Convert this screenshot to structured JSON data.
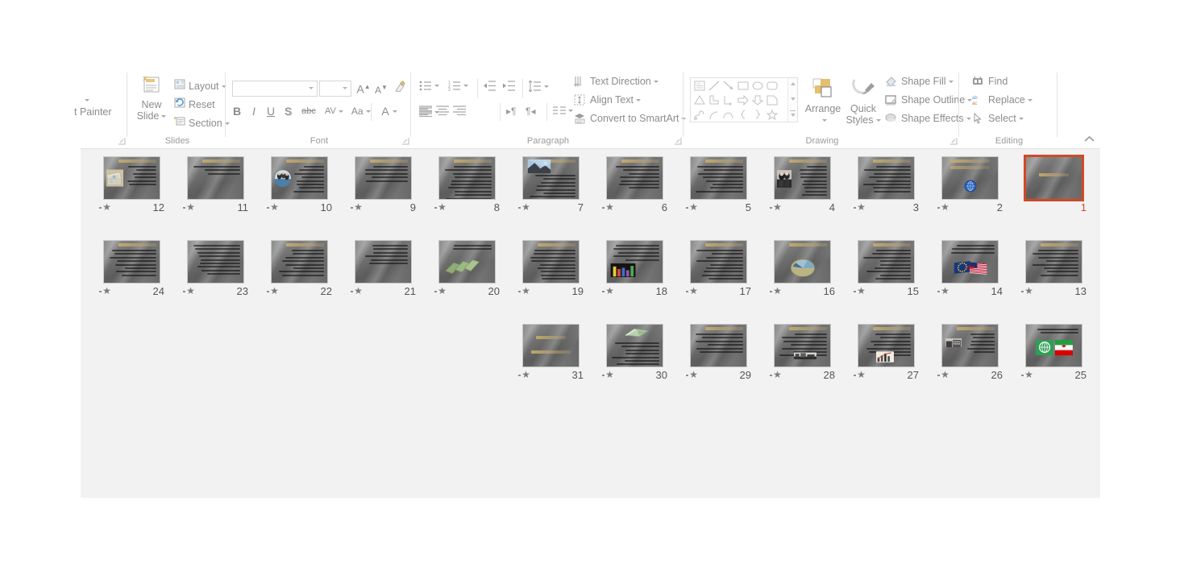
{
  "app": {
    "name": "Microsoft PowerPoint",
    "view": "slide-sorter"
  },
  "ribbon": {
    "groups": [
      {
        "id": "clipboard",
        "label": "",
        "dialog_launcher": true
      },
      {
        "id": "slides",
        "label": "Slides",
        "dialog_launcher": false
      },
      {
        "id": "font",
        "label": "Font",
        "dialog_launcher": true
      },
      {
        "id": "paragraph",
        "label": "Paragraph",
        "dialog_launcher": true
      },
      {
        "id": "drawing",
        "label": "Drawing",
        "dialog_launcher": true
      },
      {
        "id": "editing",
        "label": "Editing",
        "dialog_launcher": false
      }
    ],
    "clipboard": {
      "format_painter_label": "t Painter"
    },
    "slides": {
      "new_slide_line1": "New",
      "new_slide_line2": "Slide",
      "layout_label": "Layout",
      "reset_label": "Reset",
      "section_label": "Section"
    },
    "font": {
      "font_name_value": "",
      "font_size_value": "",
      "grow_font": "A",
      "shrink_font": "A",
      "clear_formatting": "clear-formatting-icon",
      "bold": "B",
      "italic": "I",
      "underline": "U",
      "shadow": "S",
      "strikethrough": "abc",
      "char_spacing": "AV",
      "change_case": "Aa",
      "font_color": "A"
    },
    "paragraph": {
      "text_direction_label": "Text Direction",
      "align_text_label": "Align Text",
      "convert_smartart_label": "Convert to SmartArt"
    },
    "drawing": {
      "arrange_label": "Arrange",
      "quick_styles_line1": "Quick",
      "quick_styles_line2": "Styles",
      "shape_fill_label": "Shape Fill",
      "shape_outline_label": "Shape Outline",
      "shape_effects_label": "Shape Effects"
    },
    "editing": {
      "find_label": "Find",
      "replace_label": "Replace",
      "select_label": "Select"
    },
    "collapse_ribbon": "collapse-ribbon-icon"
  },
  "slides_panel": {
    "selected_slide": 1,
    "total_rows": 3,
    "rows": [
      {
        "row": 1,
        "slides": [
          {
            "number": "12",
            "kind": "image-left",
            "title": true,
            "lines": 6,
            "animated": true,
            "img": "money"
          },
          {
            "number": "11",
            "kind": "text",
            "title": true,
            "lines": 3,
            "animated": true
          },
          {
            "number": "10",
            "kind": "image-left",
            "title": true,
            "lines": 8,
            "animated": true,
            "img": "globe-people"
          },
          {
            "number": "9",
            "kind": "text",
            "title": true,
            "lines": 5,
            "animated": true
          },
          {
            "number": "8",
            "kind": "text",
            "title": true,
            "lines": 10,
            "animated": true
          },
          {
            "number": "7",
            "kind": "image-top",
            "title": true,
            "lines": 8,
            "animated": true,
            "img": "photo-blue"
          },
          {
            "number": "6",
            "kind": "text",
            "title": true,
            "lines": 7,
            "animated": true
          },
          {
            "number": "5",
            "kind": "text",
            "title": true,
            "lines": 8,
            "animated": true
          },
          {
            "number": "4",
            "kind": "image-left",
            "title": true,
            "lines": 9,
            "animated": true,
            "img": "bw-photo"
          },
          {
            "number": "3",
            "kind": "text",
            "title": true,
            "lines": 8,
            "animated": true
          },
          {
            "number": "2",
            "kind": "title-logo",
            "heading": "International Monetary Fund (IMF)",
            "animated": true,
            "img": "imf-logo"
          },
          {
            "number": "1",
            "kind": "title-only",
            "selected": true,
            "animated": false
          }
        ]
      },
      {
        "row": 2,
        "slides": [
          {
            "number": "24",
            "kind": "text",
            "title": true,
            "lines": 8,
            "animated": true
          },
          {
            "number": "23",
            "kind": "text",
            "title": false,
            "lines": 9,
            "animated": true
          },
          {
            "number": "22",
            "kind": "text",
            "title": true,
            "lines": 8,
            "animated": true
          },
          {
            "number": "21",
            "kind": "text",
            "title": false,
            "lines": 6,
            "animated": true
          },
          {
            "number": "20",
            "kind": "image-center",
            "title": false,
            "lines": 2,
            "animated": true,
            "img": "green-cards"
          },
          {
            "number": "19",
            "kind": "text",
            "title": true,
            "lines": 9,
            "animated": true
          },
          {
            "number": "18",
            "kind": "image-center",
            "title": false,
            "lines": 5,
            "animated": true,
            "img": "bar-chart-color"
          },
          {
            "number": "17",
            "kind": "text",
            "title": true,
            "lines": 9,
            "animated": true
          },
          {
            "number": "16",
            "kind": "chart",
            "title": true,
            "animated": true,
            "img": "pie-chart"
          },
          {
            "number": "15",
            "kind": "text",
            "title": true,
            "lines": 9,
            "animated": true
          },
          {
            "number": "14",
            "kind": "image-center",
            "title": false,
            "lines": 3,
            "animated": true,
            "img": "flags-eu-us"
          },
          {
            "number": "13",
            "kind": "text",
            "title": true,
            "lines": 8,
            "animated": true
          }
        ]
      },
      {
        "row": 3,
        "slides": [
          {
            "number": "31",
            "kind": "title-only",
            "animated": true
          },
          {
            "number": "30",
            "kind": "image-top",
            "title": false,
            "lines": 9,
            "animated": true,
            "img": "green-book"
          },
          {
            "number": "29",
            "kind": "text",
            "title": true,
            "lines": 6,
            "animated": true
          },
          {
            "number": "28",
            "kind": "image-center",
            "title": true,
            "lines": 7,
            "animated": true,
            "img": "bw-strip"
          },
          {
            "number": "27",
            "kind": "image-center",
            "title": true,
            "lines": 7,
            "animated": true,
            "img": "chart-photo"
          },
          {
            "number": "26",
            "kind": "image-left",
            "title": true,
            "lines": 6,
            "animated": true,
            "img": "bw-building"
          },
          {
            "number": "25",
            "kind": "image-center",
            "title": false,
            "lines": 2,
            "animated": true,
            "img": "flags-imf-iran"
          }
        ]
      }
    ]
  },
  "colors": {
    "selection": "#d04a25",
    "work_area": "#f2f2f2",
    "ribbon_text": "#8c8c8c",
    "group_label": "#9a9a9a",
    "slide_bg": "#6e6e6e",
    "accent_gold": "#c4aa6e"
  }
}
